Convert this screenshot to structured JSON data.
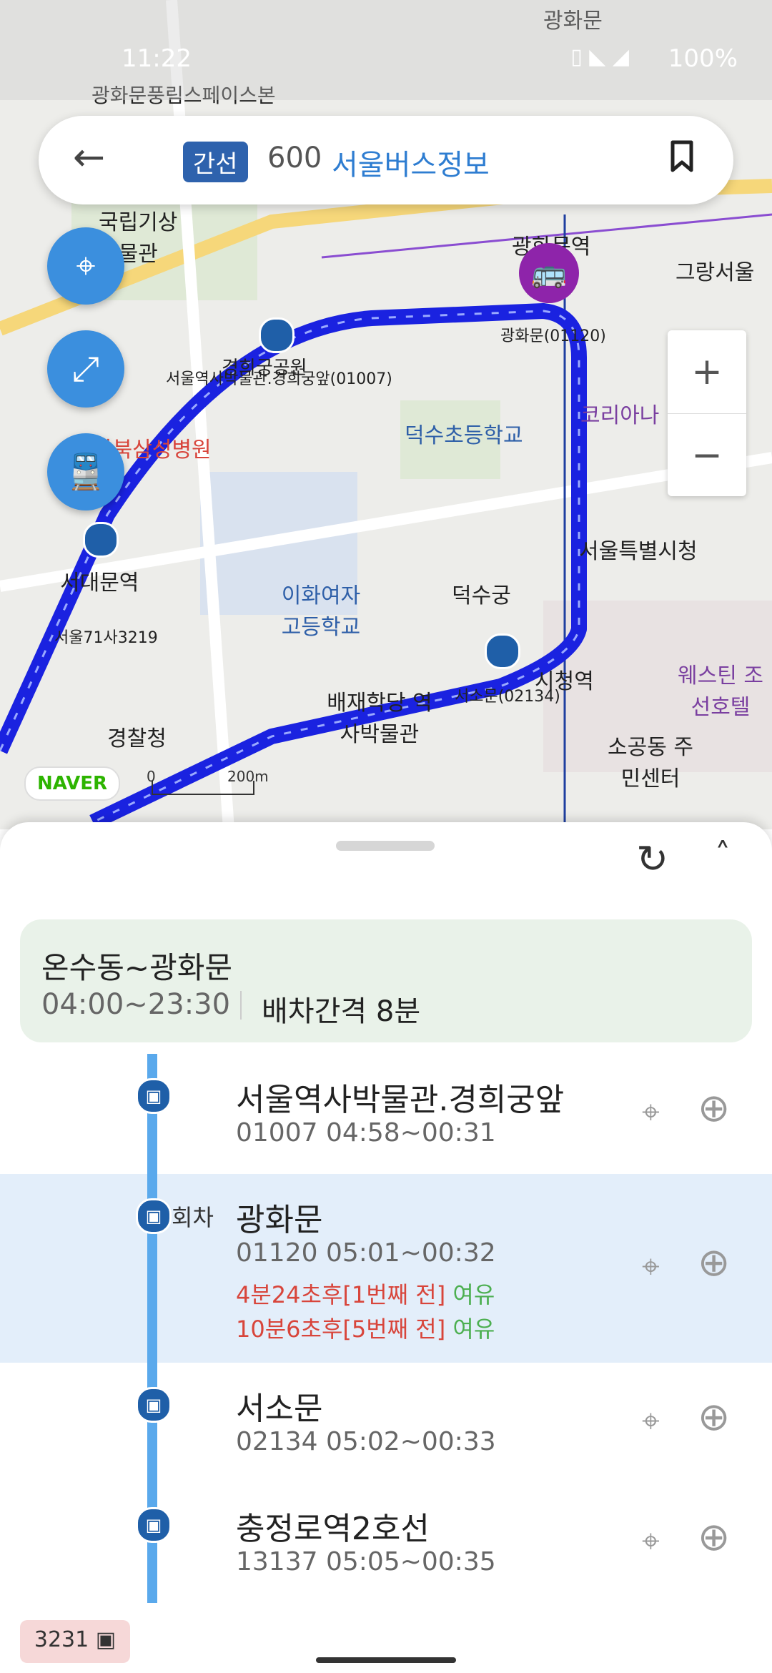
{
  "status_bar": {
    "time": "11:22",
    "battery": "100%"
  },
  "search": {
    "route_type": "간선",
    "route_number": "600",
    "agency": "서울버스정보"
  },
  "map": {
    "labels": {
      "gwanghwamun_stop": "광화문(01120)",
      "gwanghwamun_station": "광화문역",
      "museum_stop": "서울역사박물관.경희궁앞(01007)",
      "seodaemun_station": "서대문역",
      "bus_plate": "서울71사3219",
      "deoksu_school": "덕수초등학교",
      "deoksugung": "덕수궁",
      "ewha": "이화여자 고등학교",
      "seosomun_stop": "서소문(02134)",
      "city_hall_station": "시청역",
      "seoul_city_hall": "서울특별시청",
      "paichai": "배재학당 역사박물관",
      "police": "경찰청",
      "westin": "웨스틴 조선호텔",
      "sogong": "소공동 주민센터",
      "koreana": "코리아나",
      "kangbuk": "강북삼성병원",
      "gyeonghui_park": "경희궁공원",
      "gwanghwamun_top": "광화문",
      "pungrim": "광화문풍림스페이스본",
      "gukrip": "국립기상 박물관",
      "grand_seoul": "그랑서울"
    },
    "naver_logo": "NAVER",
    "scale_zero": "0",
    "scale_label": "200m",
    "zoom_in": "+",
    "zoom_out": "−"
  },
  "route_info": {
    "route": "온수동~광화문",
    "hours": "04:00~23:30",
    "interval": "배차간격 8분"
  },
  "stops": [
    {
      "name": "서울역사박물관.경희궁앞",
      "sub": "01007 04:58~00:31"
    },
    {
      "name": "광화문",
      "sub": "01120 05:01~00:32",
      "turn": "회차",
      "arrivals": [
        {
          "time": "4분24초후[1번째 전]",
          "status": "여유"
        },
        {
          "time": "10분6초후[5번째 전]",
          "status": "여유"
        }
      ]
    },
    {
      "name": "서소문",
      "sub": "02134 05:02~00:33"
    },
    {
      "name": "충정로역2호선",
      "sub": "13137 05:05~00:35"
    }
  ],
  "bottom_badge": "3231",
  "colors": {
    "route_line": "#1a22e0",
    "accent_blue": "#3b8fde",
    "delay_red": "#d8453b",
    "ok_green": "#4caf50"
  }
}
